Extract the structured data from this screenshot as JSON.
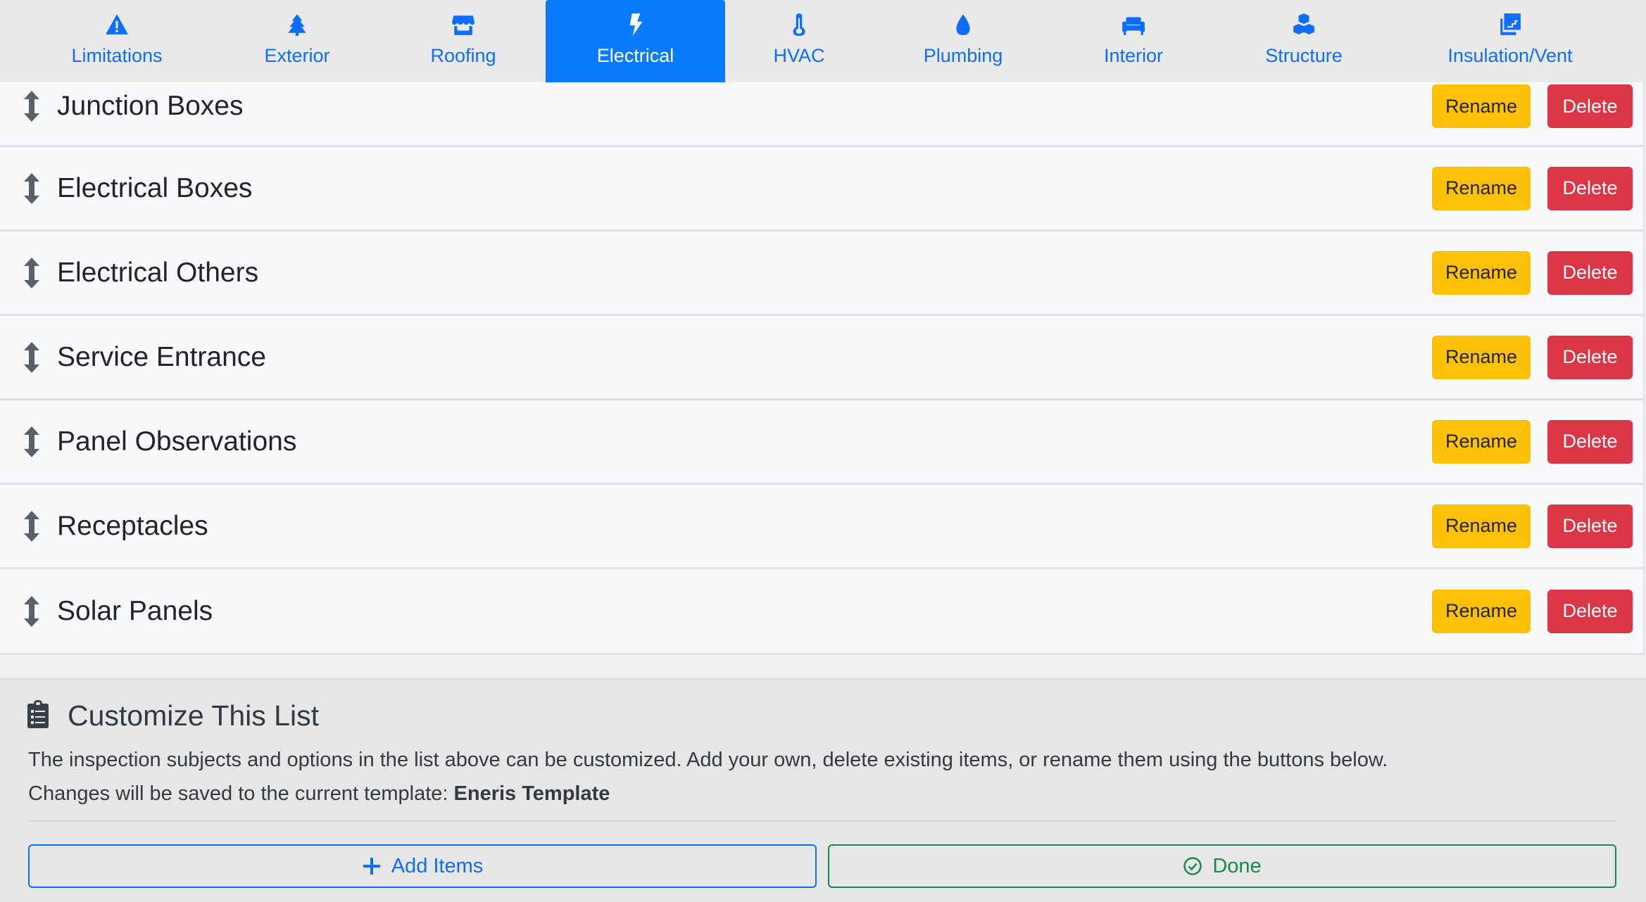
{
  "tabs": [
    {
      "label": "Limitations",
      "icon": "warning-triangle-icon",
      "active": false
    },
    {
      "label": "Exterior",
      "icon": "tree-icon",
      "active": false
    },
    {
      "label": "Roofing",
      "icon": "storefront-icon",
      "active": false
    },
    {
      "label": "Electrical",
      "icon": "lightning-bolt-icon",
      "active": true
    },
    {
      "label": "HVAC",
      "icon": "thermometer-icon",
      "active": false
    },
    {
      "label": "Plumbing",
      "icon": "water-drop-icon",
      "active": false
    },
    {
      "label": "Interior",
      "icon": "couch-icon",
      "active": false
    },
    {
      "label": "Structure",
      "icon": "cubes-icon",
      "active": false
    },
    {
      "label": "Insulation/Vent",
      "icon": "layers-icon",
      "active": false
    }
  ],
  "items": [
    {
      "title": "Junction Boxes"
    },
    {
      "title": "Electrical Boxes"
    },
    {
      "title": "Electrical Others"
    },
    {
      "title": "Service Entrance"
    },
    {
      "title": "Panel Observations"
    },
    {
      "title": "Receptacles"
    },
    {
      "title": "Solar Panels"
    }
  ],
  "buttons": {
    "rename_label": "Rename",
    "delete_label": "Delete"
  },
  "customize": {
    "title": "Customize This List",
    "description": "The inspection subjects and options in the list above can be customized. Add your own, delete existing items, or rename them using the buttons below.",
    "save_note_prefix": "Changes will be saved to the current template:",
    "template_name": "Eneris Template",
    "add_label": "Add Items",
    "done_label": "Done"
  },
  "colors": {
    "primary": "#0d6efd",
    "active_tab": "#0a7bff",
    "rename": "#ffc107",
    "delete": "#dc3545",
    "success": "#198754"
  }
}
